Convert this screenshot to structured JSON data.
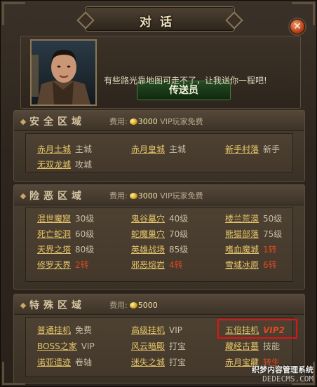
{
  "window": {
    "title": "对话",
    "close_symbol": "✕"
  },
  "npc": {
    "name": "传送员",
    "message": "有些路光靠地图可走不了，让我送你一程吧!"
  },
  "fee_label": "费用:",
  "sections": [
    {
      "title": "安全区域",
      "fee_amount": "3000",
      "fee_note": "VIP玩家免费",
      "destinations": [
        {
          "name": "赤月土城",
          "req": "主城",
          "req_color": "normal"
        },
        {
          "name": "赤月皇城",
          "req": "主城",
          "req_color": "normal"
        },
        {
          "name": "新手村落",
          "req": "新手",
          "req_color": "normal"
        },
        {
          "name": "无双龙城",
          "req": "攻城",
          "req_color": "normal"
        }
      ]
    },
    {
      "title": "险恶区域",
      "fee_amount": "3000",
      "fee_note": "VIP玩家免费",
      "destinations": [
        {
          "name": "混世魔窟",
          "req": "30级",
          "req_color": "normal"
        },
        {
          "name": "鬼谷墓穴",
          "req": "40级",
          "req_color": "normal"
        },
        {
          "name": "楼兰荒漠",
          "req": "50级",
          "req_color": "normal"
        },
        {
          "name": "死亡蛇洞",
          "req": "60级",
          "req_color": "normal"
        },
        {
          "name": "蛇魔巢穴",
          "req": "70级",
          "req_color": "normal"
        },
        {
          "name": "熊猫部落",
          "req": "75级",
          "req_color": "normal"
        },
        {
          "name": "天界之塔",
          "req": "80级",
          "req_color": "normal"
        },
        {
          "name": "英雄战场",
          "req": "85级",
          "req_color": "normal"
        },
        {
          "name": "嗜血魔城",
          "req": "1转",
          "req_color": "red"
        },
        {
          "name": "修罗天界",
          "req": "2转",
          "req_color": "red"
        },
        {
          "name": "邪恶熔岩",
          "req": "4转",
          "req_color": "red"
        },
        {
          "name": "雪域冰原",
          "req": "6转",
          "req_color": "red"
        }
      ]
    },
    {
      "title": "特殊区域",
      "fee_amount": "5000",
      "fee_note": "",
      "destinations": [
        {
          "name": "普通挂机",
          "req": "免费",
          "req_color": "normal"
        },
        {
          "name": "高级挂机",
          "req": "VIP",
          "req_color": "normal"
        },
        {
          "name": "五倍挂机",
          "req": "VIP2",
          "req_color": "vip2"
        },
        {
          "name": "BOSS之家",
          "req": "VIP",
          "req_color": "normal"
        },
        {
          "name": "风云暗殿",
          "req": "打宝",
          "req_color": "normal"
        },
        {
          "name": "藏经古墓",
          "req": "技能",
          "req_color": "normal"
        },
        {
          "name": "诺亚遗迹",
          "req": "卷轴",
          "req_color": "normal"
        },
        {
          "name": "迷失之城",
          "req": "打宝",
          "req_color": "normal"
        },
        {
          "name": "赤月宝藏",
          "req": "转生",
          "req_color": "red"
        }
      ]
    }
  ],
  "watermark": {
    "line1": "织梦内容管理系统",
    "line2": "DEDECMS.COM"
  },
  "colors": {
    "link": "#e8c66a",
    "red_req": "#e04a22",
    "highlight": "#e01414"
  }
}
